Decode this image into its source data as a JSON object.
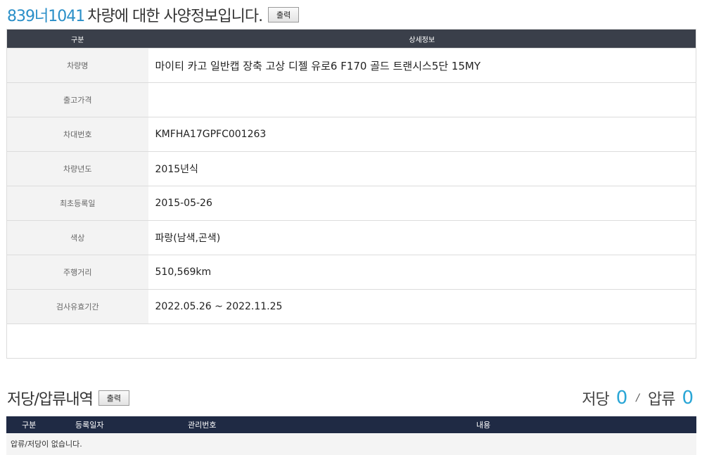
{
  "header": {
    "plate": "839너1041",
    "title_text": "차량에 대한 사양정보입니다.",
    "print_label": "출력"
  },
  "spec_table": {
    "col_label": "구분",
    "col_value": "상세정보",
    "rows": [
      {
        "label": "차량명",
        "value": "마이티 카고 일반캡 장축 고상 디젤 유로6 F170 골드 트랜시스5단 15MY"
      },
      {
        "label": "출고가격",
        "value": ""
      },
      {
        "label": "차대번호",
        "value": "KMFHA17GPFC001263"
      },
      {
        "label": "차량년도",
        "value": "2015년식"
      },
      {
        "label": "최초등록일",
        "value": "2015-05-26"
      },
      {
        "label": "색상",
        "value": "파랑(남색,곤색)"
      },
      {
        "label": "주행거리",
        "value": "510,569km"
      },
      {
        "label": "검사유효기간",
        "value": "2022.05.26 ~ 2022.11.25"
      }
    ]
  },
  "lien_section": {
    "title": "저당/압류내역",
    "print_label": "출력",
    "mortgage_label": "저당",
    "mortgage_count": "0",
    "separator": "/",
    "seizure_label": "압류",
    "seizure_count": "0",
    "columns": [
      "구분",
      "등록일자",
      "관리번호",
      "내용"
    ],
    "empty_message": "압류/저당이 없습니다."
  },
  "colors": {
    "accent": "#2a8fc8",
    "count": "#2aa6d6",
    "table_header": "#3a3f4a",
    "lien_header": "#1f2a44"
  }
}
